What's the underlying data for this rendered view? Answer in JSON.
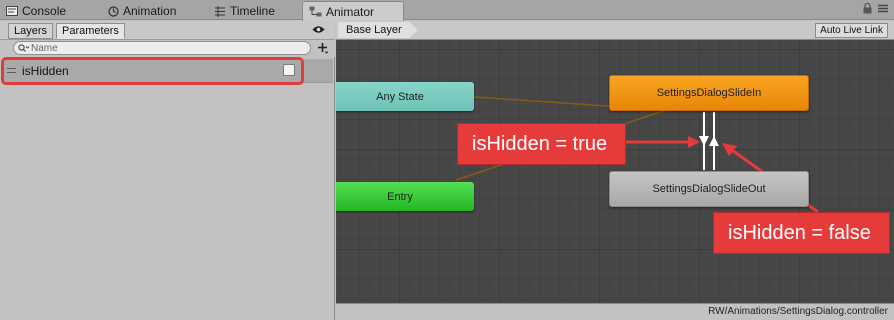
{
  "tabs": [
    {
      "label": "Console",
      "icon": "console-icon"
    },
    {
      "label": "Animation",
      "icon": "animation-icon"
    },
    {
      "label": "Timeline",
      "icon": "timeline-icon"
    },
    {
      "label": "Animator",
      "icon": "animator-icon",
      "active": true
    }
  ],
  "left_panel": {
    "tabs": {
      "layers": "Layers",
      "parameters": "Parameters"
    },
    "search_placeholder": "Name",
    "parameters": [
      {
        "name": "isHidden",
        "type": "bool",
        "value": false
      }
    ]
  },
  "graph": {
    "breadcrumb": "Base Layer",
    "auto_live_link": "Auto Live Link",
    "states": {
      "any": "Any State",
      "entry": "Entry",
      "slide_in": "SettingsDialogSlideIn",
      "slide_out": "SettingsDialogSlideOut"
    },
    "footer_path": "RW/Animations/SettingsDialog.controller"
  },
  "annotations": {
    "true_label": "isHidden = true",
    "false_label": "isHidden = false"
  },
  "colors": {
    "highlight_red": "#e23b3b",
    "callout_red": "#e53b3b",
    "any_state": "#7bcbbe",
    "entry_state": "#33c633",
    "slide_in_state": "#f09614",
    "slide_out_state": "#b7b7b7",
    "graph_background": "#474747"
  }
}
